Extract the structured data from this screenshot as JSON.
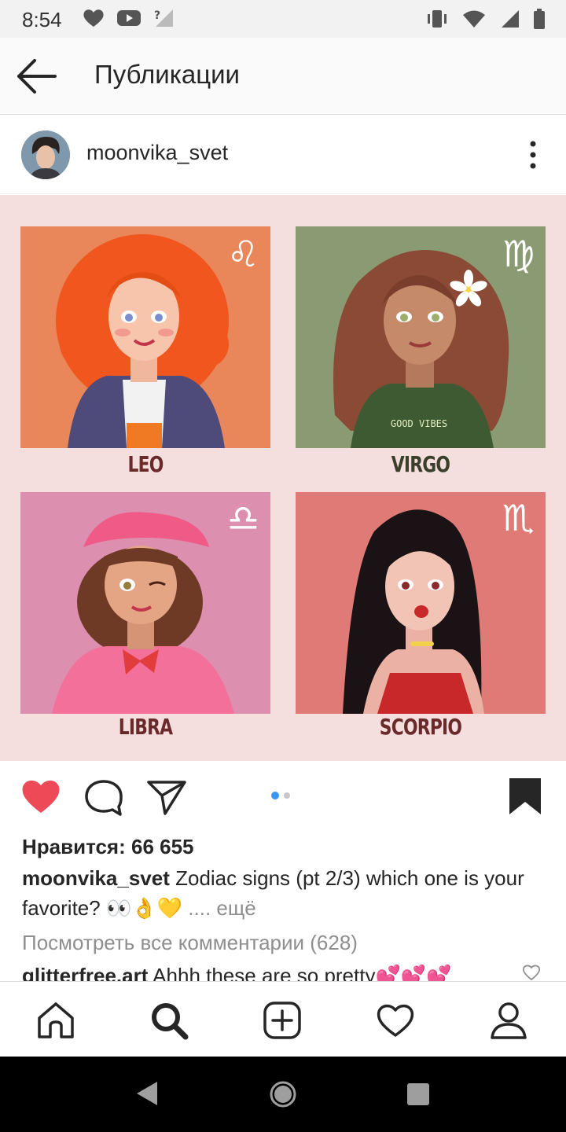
{
  "status_bar": {
    "time": "8:54"
  },
  "app_bar": {
    "title": "Публикации"
  },
  "post": {
    "username": "moonvika_svet",
    "panels": [
      {
        "label": "LEO",
        "sign": "♌",
        "bg": "#e9875a"
      },
      {
        "label": "VIRGO",
        "sign": "♍",
        "bg": "#8a9a72"
      },
      {
        "label": "LIBRA",
        "sign": "♎",
        "bg": "#dc8fae"
      },
      {
        "label": "SCORPIO",
        "sign": "♏",
        "bg": "#e07a76"
      }
    ],
    "image_texts": {
      "good_vibes": "GOOD VIBES"
    },
    "carousel": {
      "current": 1,
      "total": 2
    },
    "likes": "Нравится: 66 655",
    "caption_user": "moonvika_svet",
    "caption_text": " Zodiac signs (pt 2/3) which one is your favorite? 👀👌💛 ",
    "caption_more": ".... ещё",
    "view_comments": "Посмотреть все комментарии (628)",
    "comment": {
      "user": "glitterfree.art",
      "text": " Ahhh these are so pretty💕💕💕"
    }
  },
  "colors": {
    "like": "#ed4956",
    "dot_active": "#3897f0",
    "dot_inactive": "#c7c7c7",
    "label_text": "#6b2a2a"
  }
}
